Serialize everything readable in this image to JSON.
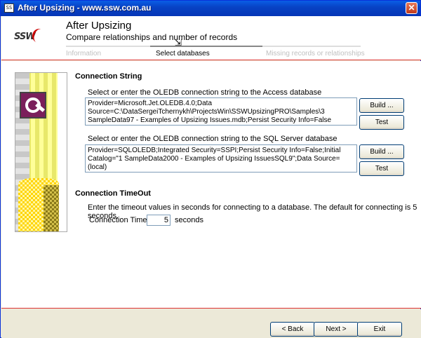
{
  "window": {
    "title": "After Upsizing - www.ssw.com.au",
    "icon_text": "SS",
    "close_glyph": "✕"
  },
  "header": {
    "logo_text": "SSW",
    "title": "After Upsizing",
    "subtitle": "Compare relationships and number of records",
    "steps": [
      "Information",
      "Select databases",
      "Missing records or relationships"
    ]
  },
  "connection": {
    "section_title": "Connection String",
    "access_label": "Select or enter the OLEDB connection string to the Access database",
    "access_value": "Provider=Microsoft.Jet.OLEDB.4.0;Data Source=C:\\DataSergeiTchernykh\\ProjectsWin\\SSWUpsizingPRO\\Samples\\3 SampleData97 - Examples of Upsizing Issues.mdb;Persist Security Info=False",
    "sql_label": "Select or enter the OLEDB connection  string to the SQL Server database",
    "sql_value": "Provider=SQLOLEDB;Integrated Security=SSPI;Persist Security Info=False;Initial Catalog=\"1 SampleData2000 - Examples of Upsizing IssuesSQL9\";Data Source=(local)",
    "build_label": "Build ...",
    "test_label": "Test"
  },
  "timeout": {
    "section_title": "Connection TimeOut",
    "description": "Enter the timeout values in seconds for connecting to a database. The default for connecting is 5 seconds.",
    "field_label": "Connection Timeout:",
    "value": "5",
    "unit": "seconds"
  },
  "footer": {
    "back_label": "< Back",
    "next_label": "Next >",
    "exit_label": "Exit"
  },
  "colors": {
    "titlebar": "#0843c5",
    "accent_line": "#dd3333"
  }
}
